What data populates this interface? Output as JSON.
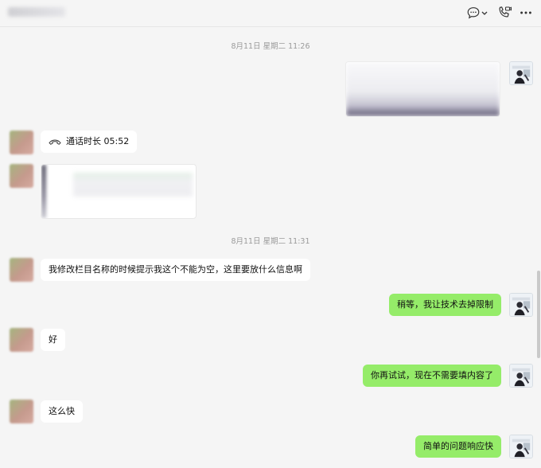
{
  "header": {
    "icons": [
      "chat-more-icon",
      "chevron-down-icon",
      "phone-video-icon",
      "more-icon"
    ]
  },
  "timestamps": [
    "8月11日 星期二 11:26",
    "8月11日 星期二 11:31"
  ],
  "messages": {
    "call": {
      "label": "通话时长 05:52",
      "icon": "phone-hangup-icon"
    },
    "m1": "我修改栏目名称的时候提示我这个不能为空，这里要放什么信息啊",
    "m2": "稍等，我让技术去掉限制",
    "m3": "好",
    "m4": "你再试试，现在不需要填内容了",
    "m5": "这么快",
    "m6": "简单的问题响应快"
  },
  "colors": {
    "background": "#f5f5f5",
    "incoming_bubble": "#ffffff",
    "outgoing_bubble": "#95ec69",
    "timestamp": "#9a9a9a"
  }
}
